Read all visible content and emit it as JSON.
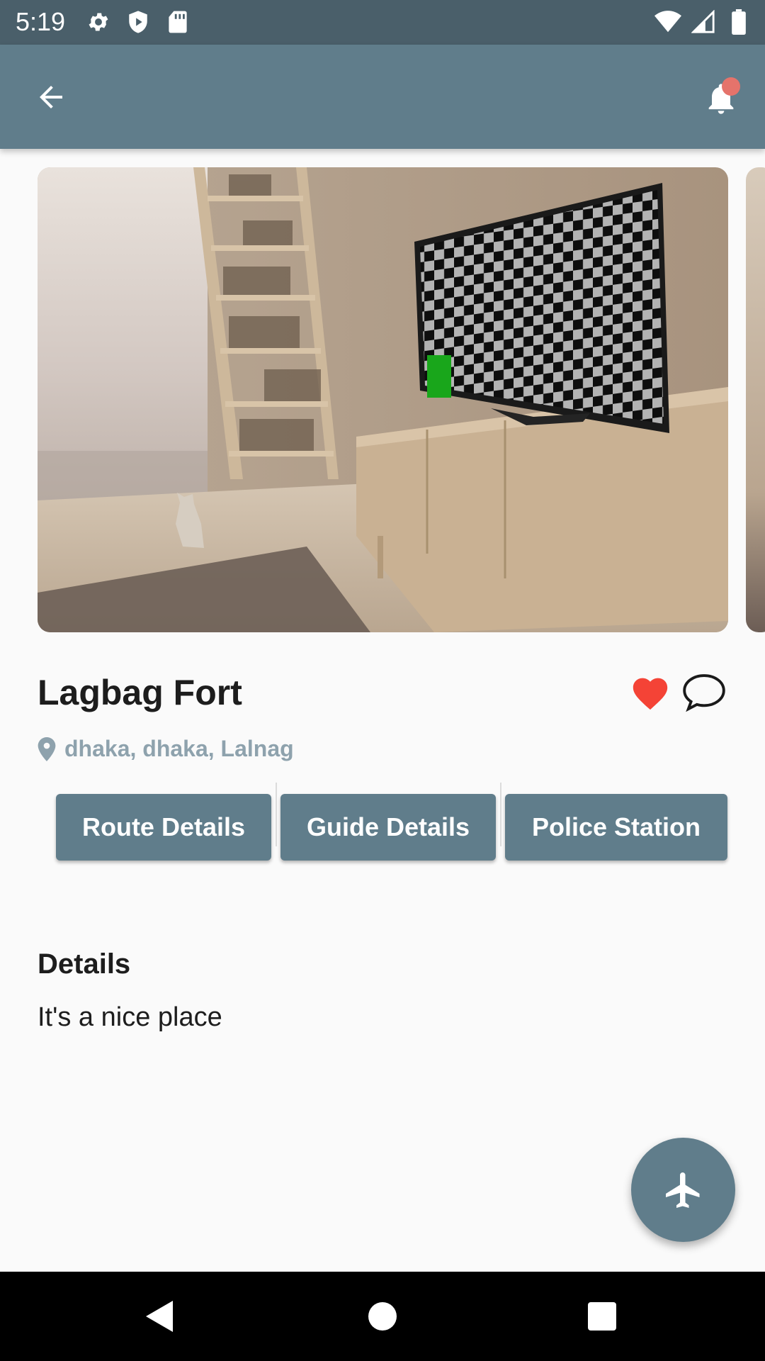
{
  "status_bar": {
    "time": "5:19",
    "left_icons": [
      "settings-icon",
      "shield-icon",
      "sd-card-icon"
    ],
    "right_icons": [
      "wifi-icon",
      "signal-icon",
      "battery-icon"
    ]
  },
  "app_bar": {
    "back_icon": "arrow-left-icon",
    "notification_icon": "bell-icon",
    "notification_badge_color": "#e5736b"
  },
  "place": {
    "title": "Lagbag Fort",
    "location": "dhaka, dhaka, Lalnag",
    "favorite_icon": "heart-icon",
    "favorite_color": "#f44336",
    "comment_icon": "chat-bubble-icon"
  },
  "actions": {
    "route_label": "Route Details",
    "guide_label": "Guide Details",
    "police_label": "Police Station"
  },
  "details": {
    "heading": "Details",
    "text": "It's a nice place"
  },
  "fab": {
    "icon": "airplane-icon"
  },
  "nav_bar": {
    "icons": [
      "back-triangle-icon",
      "home-circle-icon",
      "recents-square-icon"
    ]
  },
  "colors": {
    "primary": "#607d8b",
    "status_bar": "#4a5f6a",
    "muted_text": "#8ea2ad"
  }
}
